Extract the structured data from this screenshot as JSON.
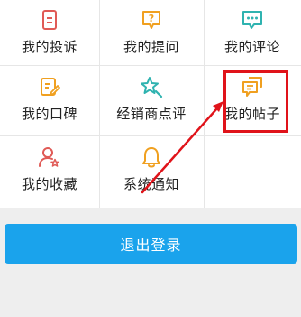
{
  "menu": {
    "items": [
      {
        "label": "我的投诉",
        "icon": "document-icon",
        "color": "#e05a56"
      },
      {
        "label": "我的提问",
        "icon": "question-bubble-icon",
        "color": "#f0a020"
      },
      {
        "label": "我的评论",
        "icon": "comment-icon",
        "color": "#2fb3b0"
      },
      {
        "label": "我的口碑",
        "icon": "edit-icon",
        "color": "#f0a020"
      },
      {
        "label": "经销商点评",
        "icon": "star-review-icon",
        "color": "#2fb3b0"
      },
      {
        "label": "我的帖子",
        "icon": "posts-icon",
        "color": "#f0a020"
      },
      {
        "label": "我的收藏",
        "icon": "favorite-person-icon",
        "color": "#e05a56"
      },
      {
        "label": "系统通知",
        "icon": "bell-icon",
        "color": "#f0a020"
      }
    ]
  },
  "logout_label": "退出登录",
  "colors": {
    "accent": "#1aa3ec",
    "annotation": "#e0131a"
  }
}
